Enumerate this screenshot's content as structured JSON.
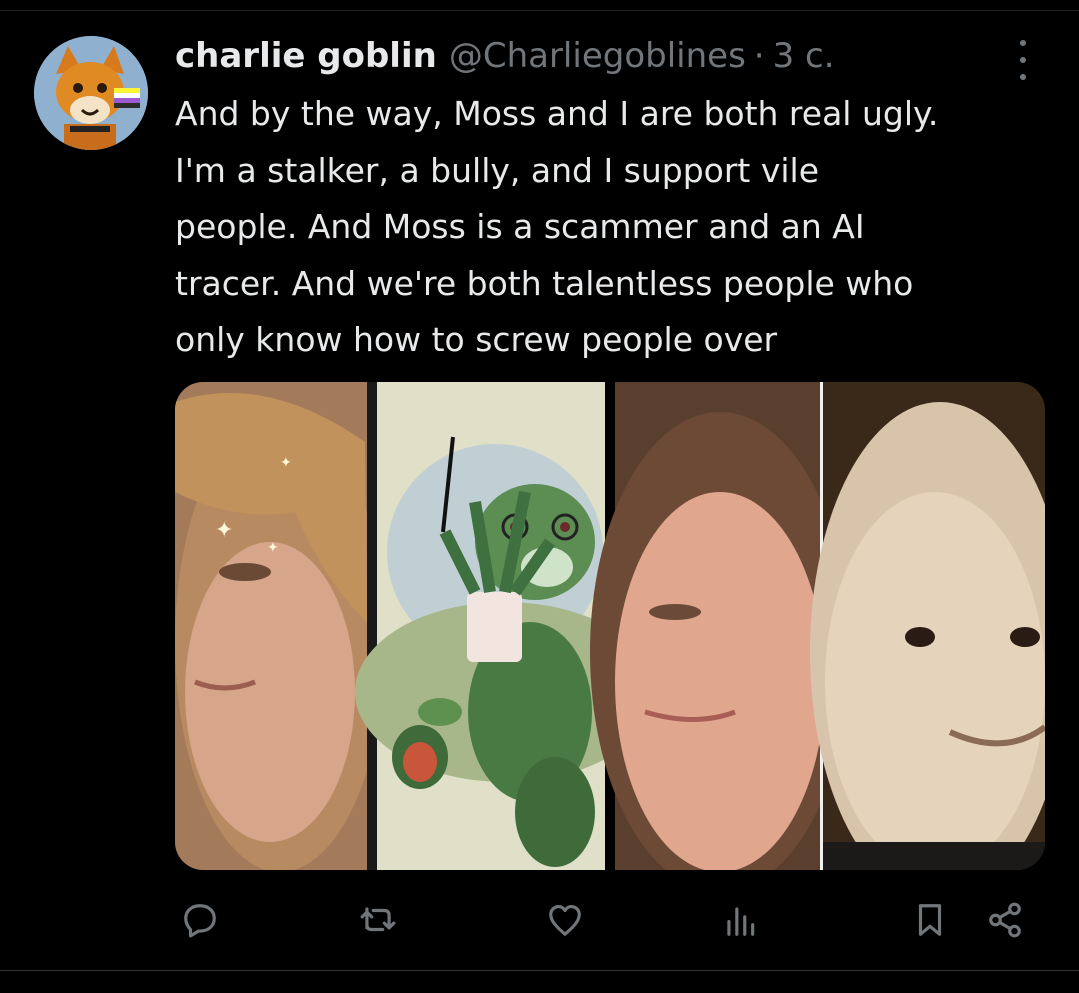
{
  "tweet": {
    "author_name": "charlie goblin",
    "author_handle": "@Charliegoblines",
    "separator": "·",
    "timestamp": "3 c.",
    "text_lines": [
      "And by the way, Moss and I are both real ugly.",
      "I'm a stalker, a bully, and I support vile",
      "people. And Moss is a scammer and an AI",
      "tracer. And we're both talentless people who",
      "only know how to screw people over"
    ]
  },
  "icons": {
    "more": "more-vertical-icon",
    "reply": "reply-icon",
    "retweet": "retweet-icon",
    "like": "heart-icon",
    "views": "views-icon",
    "bookmark": "bookmark-icon",
    "share": "share-icon"
  },
  "colors": {
    "background": "#000000",
    "text": "#e7e9ea",
    "secondary": "#71767b"
  }
}
